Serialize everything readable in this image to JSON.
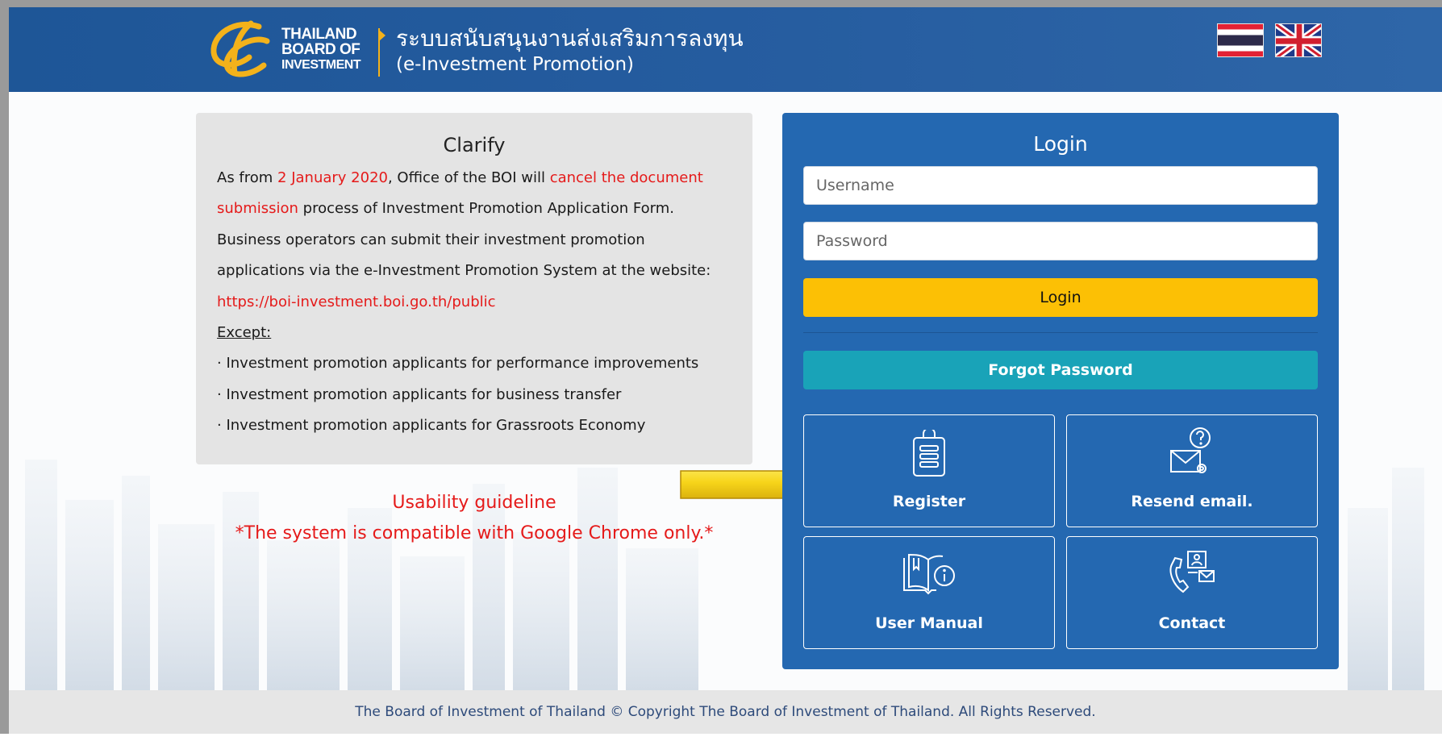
{
  "header": {
    "logo_lines": [
      "THAILAND",
      "BOARD OF",
      "INVESTMENT"
    ],
    "title_thai": "ระบบสนับสนุนงานส่งเสริมการลงทุน",
    "title_en": "(e-Investment Promotion)"
  },
  "clarify": {
    "heading": "Clarify",
    "p1_a": "As from ",
    "p1_date": "2 January 2020",
    "p1_b": ", Office of the BOI will ",
    "p1_cancel": "cancel the document submission",
    "p1_c": " process of Investment Promotion Application Form. Business operators can submit their investment promotion applications via the e-Investment Promotion System at the website: ",
    "url": "https://boi-investment.boi.go.th/public",
    "except_label": "Except:",
    "items": [
      "· Investment promotion applicants for performance improvements",
      "· Investment promotion applicants for business transfer",
      "· Investment promotion applicants for Grassroots Economy"
    ]
  },
  "usability": {
    "title": "Usability guideline",
    "note": "*The system is compatible with Google Chrome only.*"
  },
  "login": {
    "heading": "Login",
    "username_placeholder": "Username",
    "password_placeholder": "Password",
    "login_button": "Login",
    "forgot_button": "Forgot Password",
    "tiles": {
      "register": "Register",
      "resend": "Resend email.",
      "manual": "User Manual",
      "contact": "Contact"
    }
  },
  "footer": {
    "text": "The Board of Investment of Thailand © Copyright The Board of Investment of Thailand. All Rights Reserved."
  },
  "colors": {
    "header_blue": "#255c9f",
    "login_blue": "#2468b1",
    "login_yellow": "#fcc005",
    "forgot_teal": "#19a3b8",
    "alert_red": "#e51a1a",
    "clarify_gray": "#e4e4e4"
  },
  "icons": [
    "boi-logo",
    "thai-flag",
    "uk-flag",
    "clipboard-icon",
    "mail-question-icon",
    "book-info-icon",
    "phone-contact-icon",
    "arrow-pointer"
  ]
}
